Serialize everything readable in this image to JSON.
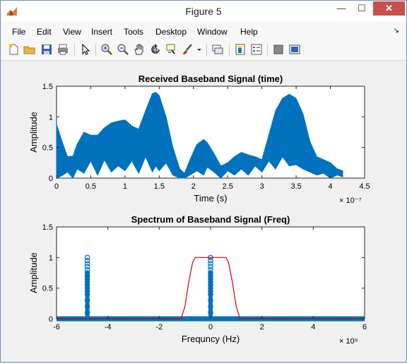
{
  "window": {
    "title": "Figure 5",
    "minimize_glyph": "—",
    "maximize_glyph": "☐",
    "close_glyph": "✕"
  },
  "menubar": {
    "items": [
      "File",
      "Edit",
      "View",
      "Insert",
      "Tools",
      "Desktop",
      "Window",
      "Help"
    ],
    "dock_glyph": "↘"
  },
  "toolbar": {
    "icons": [
      "new-figure-icon",
      "open-file-icon",
      "save-figure-icon",
      "print-figure-icon",
      "edit-plot-arrow-icon",
      "zoom-in-icon",
      "zoom-out-icon",
      "pan-hand-icon",
      "rotate-3d-icon",
      "data-cursor-icon",
      "brush-icon",
      "brush-dropdown-icon",
      "link-plot-icon",
      "insert-colorbar-icon",
      "insert-legend-icon",
      "hide-plot-tools-icon",
      "show-plot-tools-icon"
    ]
  },
  "colors": {
    "series": "#0072bd",
    "filter": "#d00000",
    "axes_bg": "#ffffff",
    "figure_bg": "#f0f0f0",
    "close_button": "#c7504c"
  },
  "chart_data": [
    {
      "type": "area",
      "title": "Received Baseband Signal (time)",
      "xlabel": "Time (s)",
      "ylabel": "Amplitude",
      "x_exponent": "× 10⁻⁷",
      "xlim": [
        0,
        4.5
      ],
      "ylim": [
        0,
        1.5
      ],
      "xticks": [
        "0",
        "0.5",
        "1",
        "1.5",
        "2",
        "2.5",
        "3",
        "3.5",
        "4",
        "4.5"
      ],
      "yticks": [
        "0",
        "0.5",
        "1",
        "1.5"
      ],
      "x": [
        0,
        0.08,
        0.16,
        0.24,
        0.3,
        0.4,
        0.5,
        0.6,
        0.7,
        0.8,
        0.9,
        1.0,
        1.1,
        1.2,
        1.3,
        1.4,
        1.45,
        1.5,
        1.6,
        1.7,
        1.8,
        1.87,
        1.95,
        2.05,
        2.15,
        2.2,
        2.3,
        2.4,
        2.5,
        2.6,
        2.7,
        2.8,
        2.9,
        3.0,
        3.1,
        3.2,
        3.3,
        3.4,
        3.5,
        3.6,
        3.7,
        3.8,
        3.9,
        4.0,
        4.1,
        4.18
      ],
      "upper": [
        0.88,
        0.6,
        0.35,
        0.36,
        0.55,
        0.75,
        0.7,
        0.7,
        0.82,
        0.9,
        0.93,
        0.95,
        0.85,
        0.8,
        1.1,
        1.38,
        1.4,
        1.35,
        1.0,
        0.5,
        0.15,
        0.08,
        0.3,
        0.55,
        0.63,
        0.58,
        0.4,
        0.2,
        0.25,
        0.35,
        0.42,
        0.38,
        0.35,
        0.3,
        0.7,
        1.1,
        1.3,
        1.37,
        1.3,
        1.05,
        0.6,
        0.35,
        0.3,
        0.25,
        0.15,
        0.12
      ],
      "lower": [
        0,
        0.04,
        0.1,
        0.0,
        0.15,
        0.08,
        0.28,
        0.05,
        0.3,
        0.1,
        0.2,
        0.12,
        0.28,
        0.08,
        0.35,
        0.1,
        0.2,
        0.12,
        0.25,
        0.05,
        0.0,
        0.0,
        0.05,
        0.12,
        0.05,
        0.18,
        0.1,
        0.0,
        0.12,
        0.05,
        0.15,
        0.05,
        0.2,
        0.1,
        0.28,
        0.15,
        0.35,
        0.2,
        0.22,
        0.15,
        0.1,
        0.05,
        0.08,
        0.0,
        0.05,
        0.02
      ]
    },
    {
      "type": "scatter",
      "title": "Spectrum of Baseband Signal (Freq)",
      "xlabel": "Frequncy (Hz)",
      "ylabel": "Amplitude",
      "x_exponent": "× 10⁹",
      "xlim": [
        -6,
        6
      ],
      "ylim": [
        0,
        1.5
      ],
      "xticks": [
        "-6",
        "-4",
        "-2",
        "0",
        "2",
        "4",
        "6"
      ],
      "yticks": [
        "0",
        "0.5",
        "1",
        "1.5"
      ],
      "baseline": {
        "x_from": -6,
        "x_to": 6,
        "y": 0
      },
      "spikes": [
        {
          "x": -4.8,
          "y_values": [
            1.0,
            0.95,
            0.9,
            0.85,
            0.8,
            0.75,
            0.7,
            0.65,
            0.6,
            0.55,
            0.5,
            0.45,
            0.4,
            0.3,
            0.2,
            0.1
          ]
        },
        {
          "x": 0,
          "y_values": [
            1.0,
            0.95,
            0.9,
            0.85,
            0.8,
            0.75,
            0.7,
            0.65,
            0.6,
            0.55,
            0.5,
            0.45,
            0.4,
            0.3,
            0.2,
            0.1
          ]
        }
      ],
      "filter_line": {
        "x": [
          -6,
          -1.15,
          -1.0,
          -0.85,
          -0.7,
          -0.6,
          0.6,
          0.7,
          0.85,
          1.0,
          1.15,
          6
        ],
        "y": [
          0,
          0,
          0.2,
          0.6,
          0.92,
          1.0,
          1.0,
          0.92,
          0.6,
          0.2,
          0,
          0
        ]
      }
    }
  ]
}
